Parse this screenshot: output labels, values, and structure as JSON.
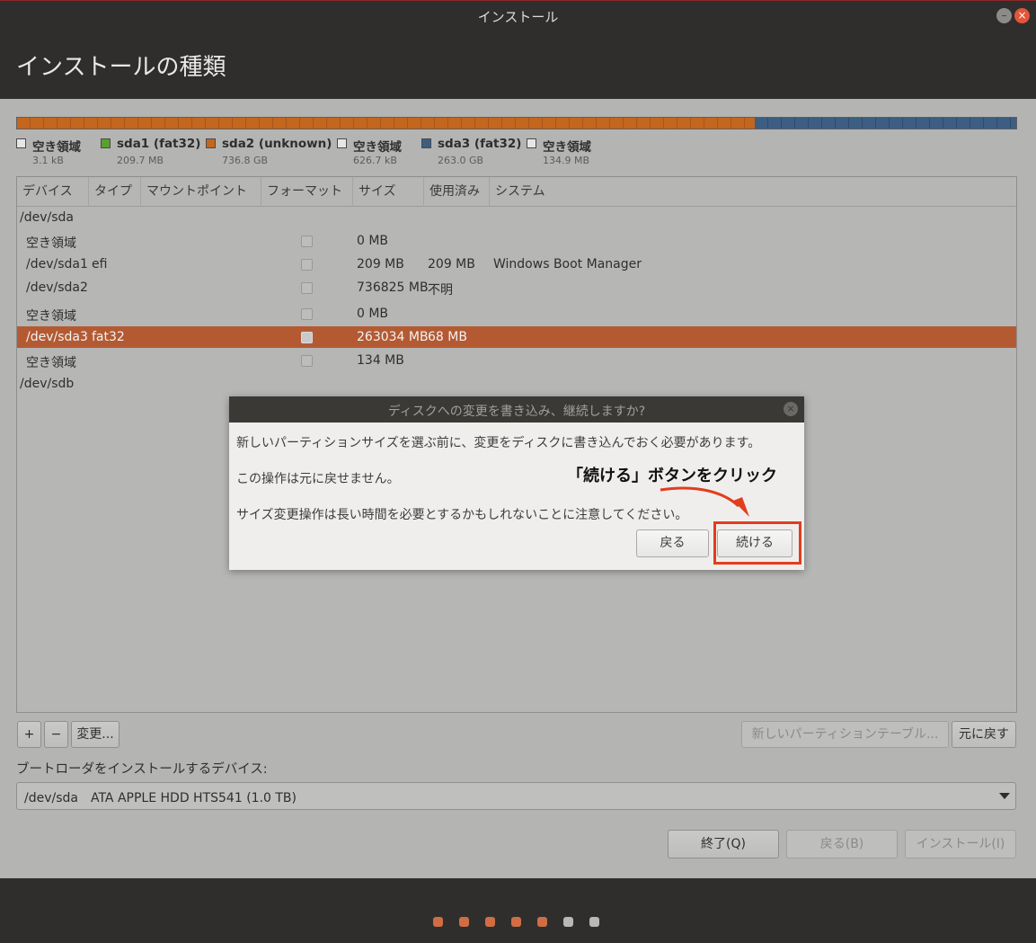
{
  "window": {
    "title": "インストール",
    "min_icon": "minimize-icon",
    "close_icon": "close-icon"
  },
  "header": {
    "title": "インストールの種類"
  },
  "legend": [
    {
      "name": "空き領域",
      "size": "3.1 kB",
      "color": "#e6e6e6"
    },
    {
      "name": "sda1 (fat32)",
      "size": "209.7 MB",
      "color": "#5aa02c"
    },
    {
      "name": "sda2 (unknown)",
      "size": "736.8 GB",
      "color": "#c3661e"
    },
    {
      "name": "空き領域",
      "size": "626.7 kB",
      "color": "#e6e6e6"
    },
    {
      "name": "sda3 (fat32)",
      "size": "263.0 GB",
      "color": "#3d5e83"
    },
    {
      "name": "空き領域",
      "size": "134.9 MB",
      "color": "#e6e6e6"
    }
  ],
  "table": {
    "headers": [
      "デバイス",
      "タイプ",
      "マウントポイント",
      "フォーマット",
      "サイズ",
      "使用済み",
      "システム"
    ],
    "rows": [
      {
        "device": "/dev/sda",
        "type": "",
        "size": "",
        "used": "",
        "system": "",
        "group": true
      },
      {
        "device": "空き領域",
        "type": "",
        "size": "0 MB",
        "used": "",
        "system": ""
      },
      {
        "device": "/dev/sda1",
        "type": "efi",
        "size": "209 MB",
        "used": "209 MB",
        "system": "Windows Boot Manager"
      },
      {
        "device": "/dev/sda2",
        "type": "",
        "size": "736825 MB",
        "used": "不明",
        "system": ""
      },
      {
        "device": "空き領域",
        "type": "",
        "size": "0 MB",
        "used": "",
        "system": ""
      },
      {
        "device": "/dev/sda3",
        "type": "fat32",
        "size": "263034 MB",
        "used": "68 MB",
        "system": "",
        "selected": true
      },
      {
        "device": "空き領域",
        "type": "",
        "size": "134 MB",
        "used": "",
        "system": ""
      },
      {
        "device": "/dev/sdb",
        "type": "",
        "size": "",
        "used": "",
        "system": "",
        "group": true
      }
    ]
  },
  "controls": {
    "add": "+",
    "remove": "−",
    "change": "変更...",
    "new_table": "新しいパーティションテーブル...",
    "revert": "元に戻す"
  },
  "bootloader": {
    "label": "ブートローダをインストールするデバイス:",
    "value": "/dev/sda　ATA APPLE HDD HTS541 (1.0 TB)"
  },
  "nav": {
    "quit": "終了(Q)",
    "back": "戻る(B)",
    "install": "インストール(I)"
  },
  "dialog": {
    "title": "ディスクへの変更を書き込み、継続しますか?",
    "line1": "新しいパーティションサイズを選ぶ前に、変更をディスクに書き込んでおく必要があります。",
    "line2": "この操作は元に戻せません。",
    "line3": "サイズ変更操作は長い時間を必要とするかもしれないことに注意してください。",
    "back": "戻る",
    "continue": "続ける"
  },
  "annotation": {
    "text": "「続ける」ボタンをクリック",
    "color": "#e23d1d"
  },
  "progress": {
    "total_steps": 7,
    "completed_steps": 5
  }
}
